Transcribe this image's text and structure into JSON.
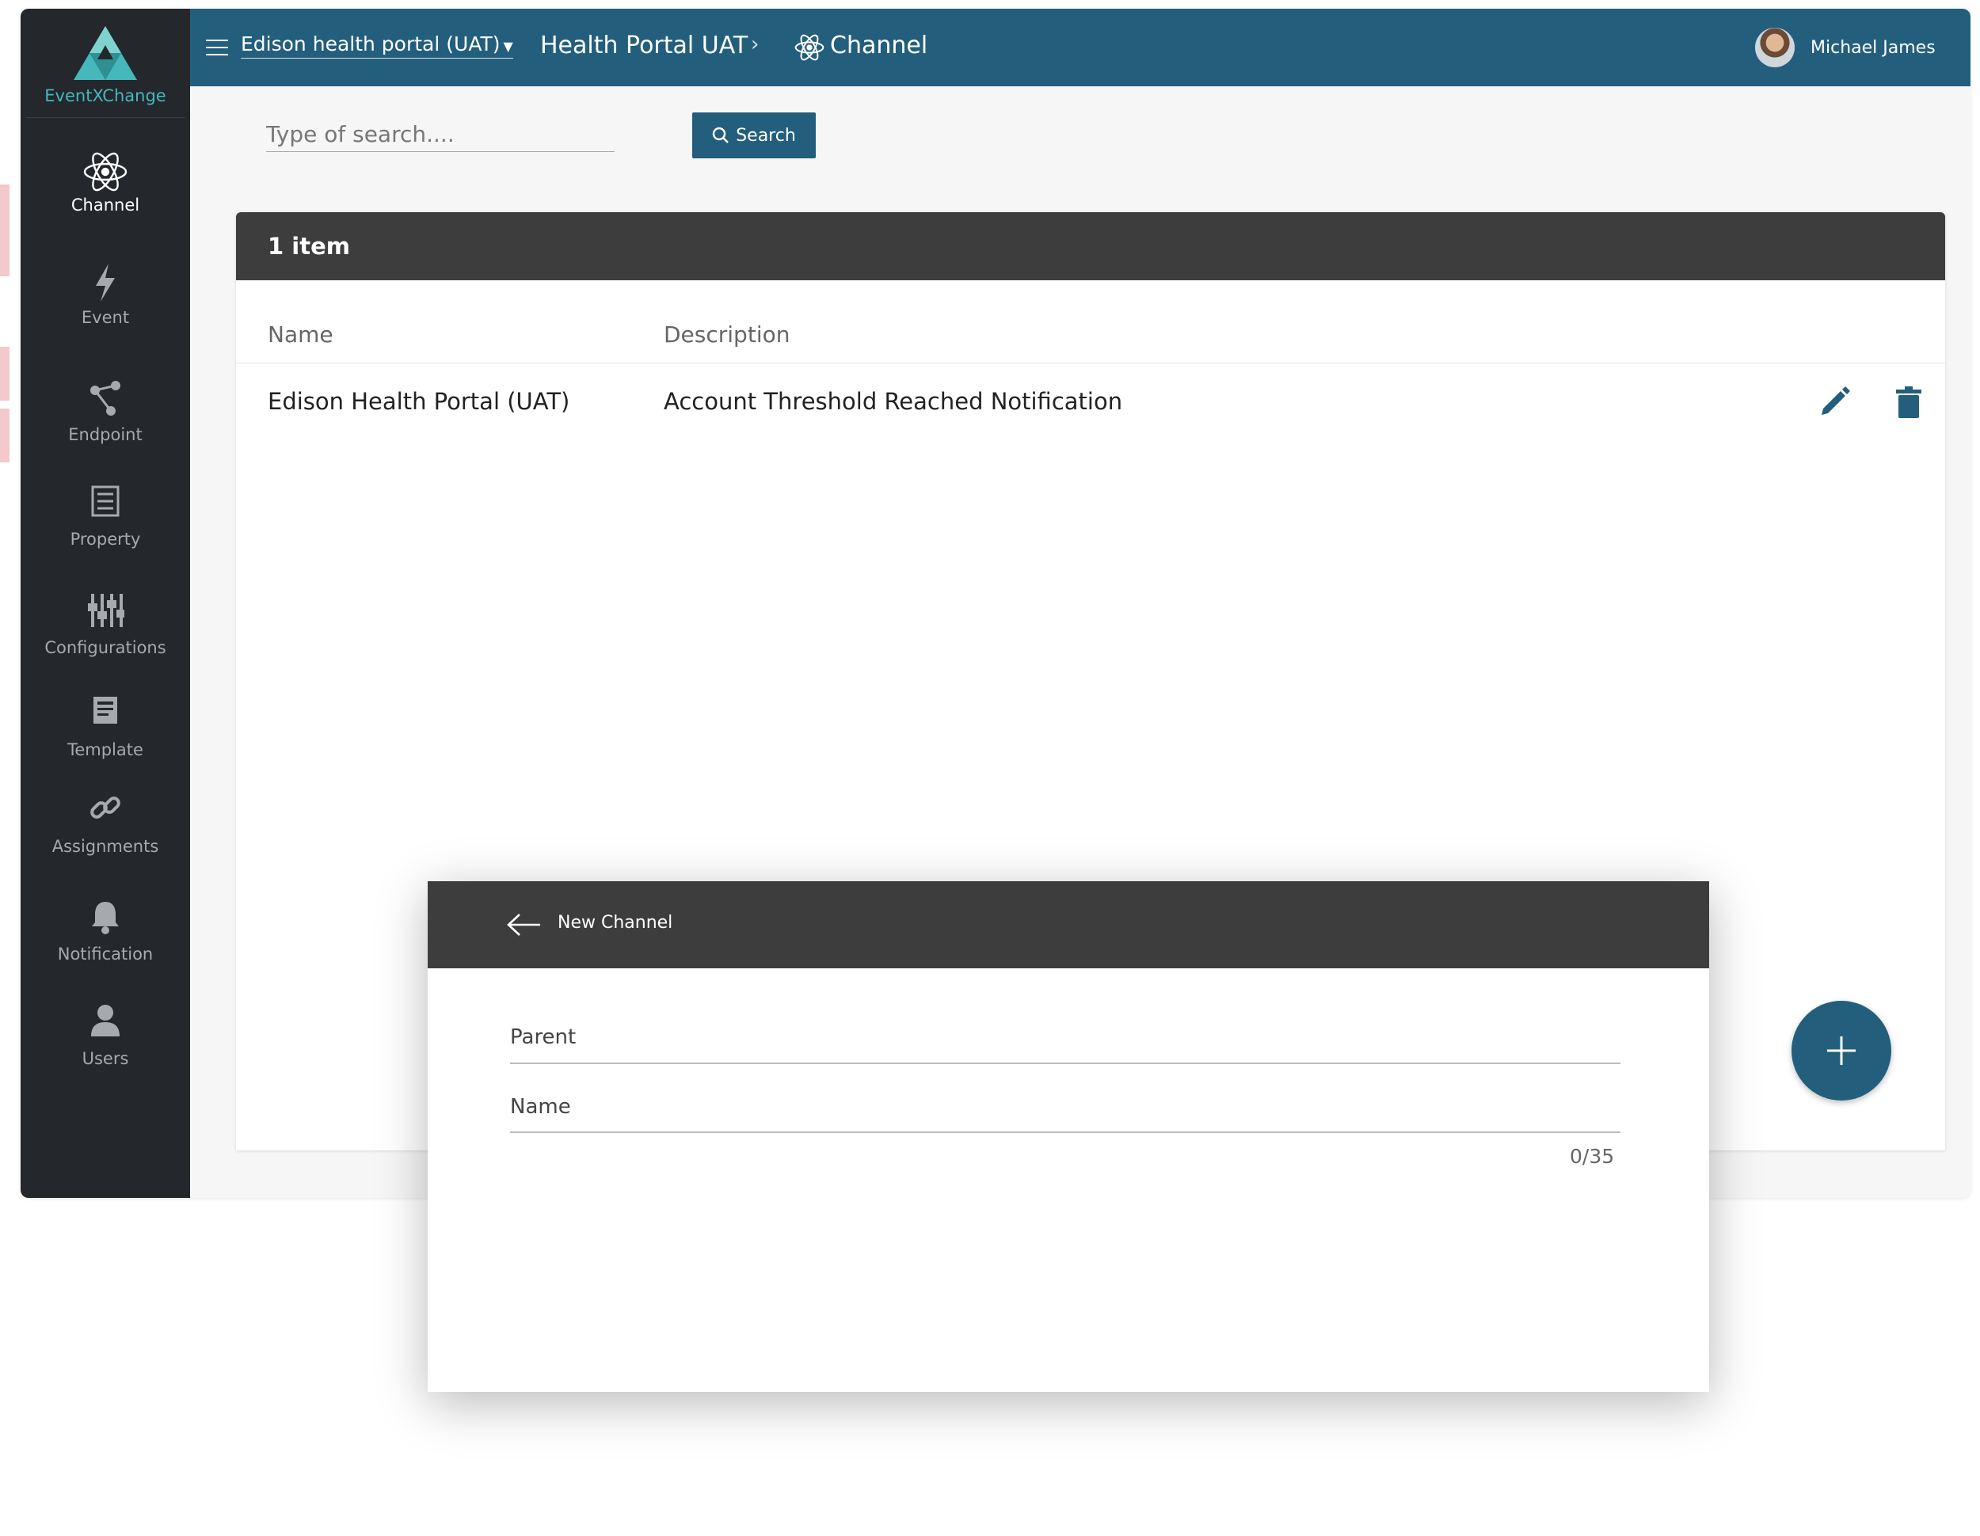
{
  "app": {
    "brand_name": "EventXChange",
    "accent_color": "#235f7c",
    "brand_color": "#45b8bc"
  },
  "sidebar": {
    "items": [
      {
        "label": "Channel",
        "icon": "atom-icon",
        "active": true
      },
      {
        "label": "Event",
        "icon": "lightning-icon"
      },
      {
        "label": "Endpoint",
        "icon": "share-nodes-icon"
      },
      {
        "label": "Property",
        "icon": "list-icon"
      },
      {
        "label": "Configurations",
        "icon": "sliders-icon"
      },
      {
        "label": "Template",
        "icon": "document-icon"
      },
      {
        "label": "Assignments",
        "icon": "link-icon"
      },
      {
        "label": "Notification",
        "icon": "bell-icon"
      },
      {
        "label": "Users",
        "icon": "user-icon"
      }
    ]
  },
  "topbar": {
    "portal_select": "Edison health portal (UAT)",
    "breadcrumb_main": "Health Portal UAT",
    "breadcrumb_sub": "Channel",
    "user_name": "Michael James"
  },
  "search": {
    "placeholder": "Type of search....",
    "button_label": "Search"
  },
  "list": {
    "count_label": "1 item",
    "columns": [
      "Name",
      "Description"
    ],
    "rows": [
      {
        "name": "Edison Health Portal (UAT)",
        "description": "Account Threshold Reached Notification"
      }
    ]
  },
  "dialog": {
    "title": "New Channel",
    "fields": [
      {
        "label": "Parent"
      },
      {
        "label": "Name"
      }
    ],
    "name_counter": "0/35"
  }
}
